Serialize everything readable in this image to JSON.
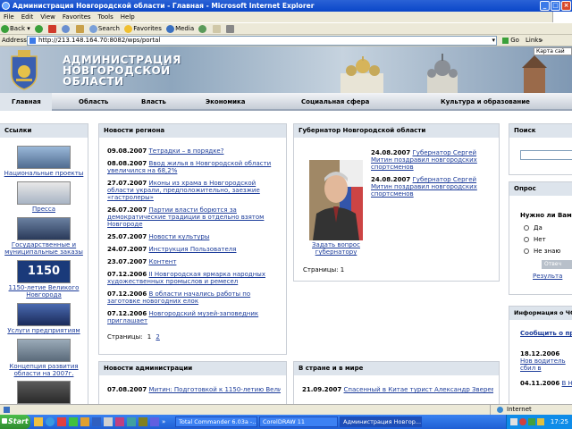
{
  "window": {
    "title": "Администрация Новгородской области - Главная - Microsoft Internet Explorer"
  },
  "menu": [
    "File",
    "Edit",
    "View",
    "Favorites",
    "Tools",
    "Help"
  ],
  "toolbar": {
    "back": "Back",
    "search": "Search",
    "favorites": "Favorites",
    "media": "Media"
  },
  "address": {
    "label": "Address",
    "url": "http://213.148.164.70:8082/wps/portal",
    "go": "Go",
    "links": "Links"
  },
  "site": {
    "title_line1": "АДМИНИСТРАЦИЯ",
    "title_line2": "НОВГОРОДСКОЙ",
    "title_line3": "ОБЛАСТИ",
    "map_tab": "Карта сай"
  },
  "nav": [
    "Главная",
    "Область",
    "Власть",
    "Экономика",
    "Социальная сфера",
    "Культура и образование"
  ],
  "links_panel": {
    "title": "Ссылки",
    "items": [
      "Национальные проекты",
      "Пресса",
      "Государственные и муниципальные заказы",
      "1150-летие Великого Новгорода",
      "Услуги предприятиям",
      "Концепция развития области на 2007г."
    ],
    "thumb_1150": "1150"
  },
  "region_news": {
    "title": "Новости региона",
    "items": [
      {
        "date": "09.08.2007",
        "text": "Тетрадки – в порядке?"
      },
      {
        "date": "08.08.2007",
        "text": "Ввод жилья в Новгородской области увеличился на 68,2%"
      },
      {
        "date": "27.07.2007",
        "text": "Иконы из храма в Новгородской области украли, предположительно, заезжие «гастролеры»"
      },
      {
        "date": "26.07.2007",
        "text": "Партии власти борются за демократические традиции в отдельно взятом Новгороде"
      },
      {
        "date": "25.07.2007",
        "text": "Новости культуры"
      },
      {
        "date": "24.07.2007",
        "text": "Инструкция Пользователя"
      },
      {
        "date": "23.07.2007",
        "text": "Контент"
      },
      {
        "date": "07.12.2006",
        "text": "II Новгородская ярмарка народных художественных промыслов и ремесел"
      },
      {
        "date": "07.12.2006",
        "text": "В области начались работы по заготовке новогодних елок"
      },
      {
        "date": "07.12.2006",
        "text": "Новгородский музей-заповедник приглашает"
      }
    ],
    "pages_label": "Страницы:",
    "page1": "1",
    "page2": "2"
  },
  "governor": {
    "title": "Губернатор Новгородской области",
    "ask": "Задать вопрос губернатору",
    "pages": "Страницы:  1",
    "items": [
      {
        "date": "24.08.2007",
        "text": "Губернатор Сергей Митин поздравил новгородских спортсменов"
      },
      {
        "date": "24.08.2007",
        "text": "Губернатор Сергей Митин поздравил новгородских спортсменов"
      }
    ]
  },
  "search": {
    "title": "Поиск"
  },
  "poll": {
    "title": "Опрос",
    "question": "Нужно ли Вам с",
    "options": [
      "Да",
      "Нет",
      "Не знаю"
    ],
    "vote": "Отвеч",
    "results": "Результа"
  },
  "cs_info": {
    "title": "Информация о ЧС",
    "link1": "Сообщить о про",
    "item1_date": "18.12.2006",
    "item1_text": "Нов водитель сбил в врезался в дерев",
    "item2_date": "04.11.2006",
    "item2_text": "В Нов"
  },
  "admin_news": {
    "title": "Новости администрации",
    "item_date": "07.08.2007",
    "item_text": "Митин: Подготовкой к 1150-летию Великого"
  },
  "world_news": {
    "title": "В стране и в мире",
    "item_date": "21.09.2007",
    "item_text": "Спасенный в Китае турист Александр Зверев: Все"
  },
  "status": {
    "zone": "Internet"
  },
  "taskbar": {
    "start": "Start",
    "tasks": [
      "Total Commander 6.03a -...",
      "CorelDRAW 11",
      "Администрация Новгор..."
    ],
    "time": "17:25"
  }
}
